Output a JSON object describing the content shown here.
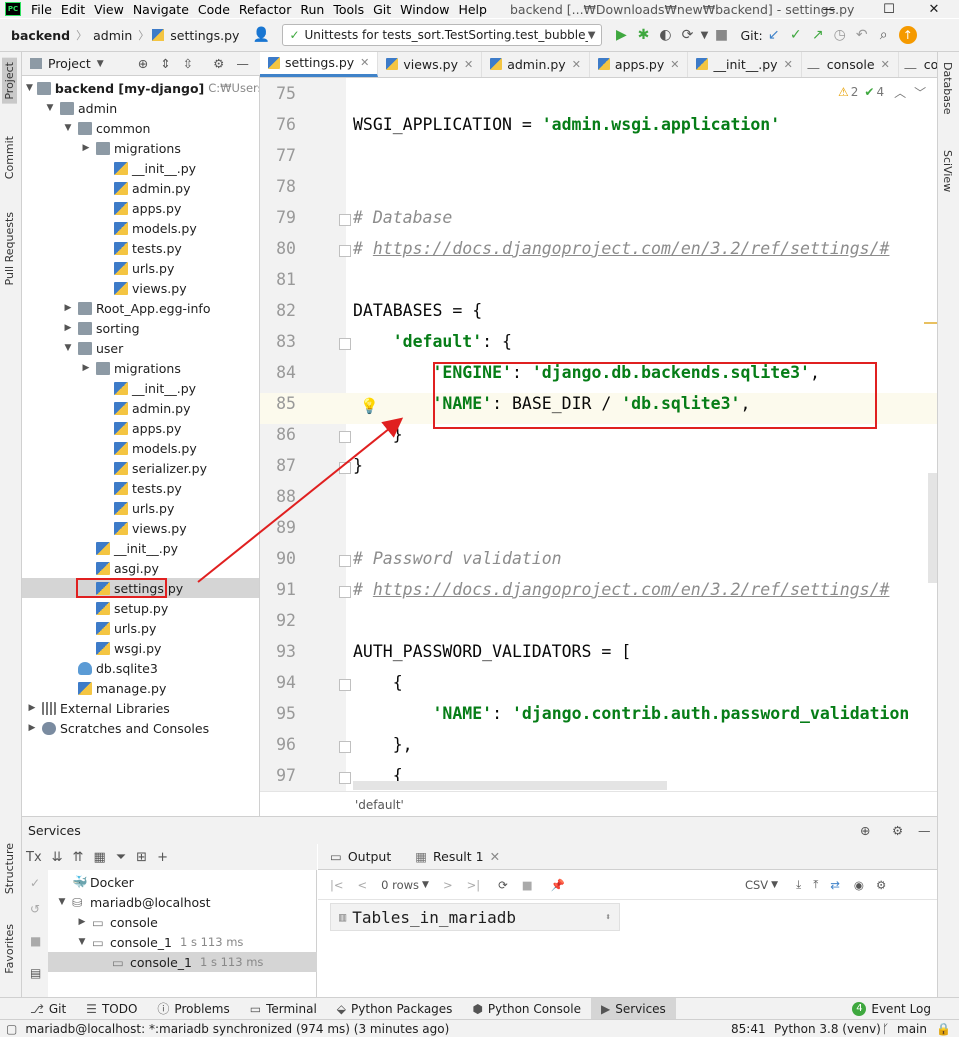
{
  "menubar": {
    "items": [
      "File",
      "Edit",
      "View",
      "Navigate",
      "Code",
      "Refactor",
      "Run",
      "Tools",
      "Git",
      "Window",
      "Help"
    ],
    "window_title": "backend [...₩Downloads₩new₩backend] - settings.py",
    "logo": "PC"
  },
  "toolbar": {
    "crumbs": [
      "backend",
      "admin",
      "settings.py"
    ],
    "run_config": "Unittests for tests_sort.TestSorting.test_bubble_sort",
    "git_label": "Git:"
  },
  "left_strip": {
    "tabs": [
      "Project",
      "Commit",
      "Pull Requests",
      "Structure",
      "Favorites"
    ]
  },
  "right_strip": {
    "tabs": [
      "Database",
      "SciView"
    ]
  },
  "project": {
    "header": "Project",
    "tree": [
      {
        "label": "backend [my-django]",
        "hint": "C:₩Users₩bit",
        "icon": "folder",
        "depth": 0,
        "arrow": "down",
        "bold": true
      },
      {
        "label": "admin",
        "icon": "folder",
        "depth": 1,
        "arrow": "down"
      },
      {
        "label": "common",
        "icon": "folder",
        "depth": 2,
        "arrow": "down"
      },
      {
        "label": "migrations",
        "icon": "folder",
        "depth": 3,
        "arrow": "right"
      },
      {
        "label": "__init__.py",
        "icon": "py",
        "depth": 4
      },
      {
        "label": "admin.py",
        "icon": "py",
        "depth": 4
      },
      {
        "label": "apps.py",
        "icon": "py",
        "depth": 4
      },
      {
        "label": "models.py",
        "icon": "py",
        "depth": 4
      },
      {
        "label": "tests.py",
        "icon": "py",
        "depth": 4
      },
      {
        "label": "urls.py",
        "icon": "py",
        "depth": 4
      },
      {
        "label": "views.py",
        "icon": "py",
        "depth": 4
      },
      {
        "label": "Root_App.egg-info",
        "icon": "folder",
        "depth": 2,
        "arrow": "right"
      },
      {
        "label": "sorting",
        "icon": "folder",
        "depth": 2,
        "arrow": "right"
      },
      {
        "label": "user",
        "icon": "folder",
        "depth": 2,
        "arrow": "down"
      },
      {
        "label": "migrations",
        "icon": "folder",
        "depth": 3,
        "arrow": "right"
      },
      {
        "label": "__init__.py",
        "icon": "py",
        "depth": 4
      },
      {
        "label": "admin.py",
        "icon": "py",
        "depth": 4
      },
      {
        "label": "apps.py",
        "icon": "py",
        "depth": 4
      },
      {
        "label": "models.py",
        "icon": "py",
        "depth": 4
      },
      {
        "label": "serializer.py",
        "icon": "py",
        "depth": 4
      },
      {
        "label": "tests.py",
        "icon": "py",
        "depth": 4
      },
      {
        "label": "urls.py",
        "icon": "py",
        "depth": 4
      },
      {
        "label": "views.py",
        "icon": "py",
        "depth": 4
      },
      {
        "label": "__init__.py",
        "icon": "py",
        "depth": 3
      },
      {
        "label": "asgi.py",
        "icon": "py",
        "depth": 3
      },
      {
        "label": "settings.py",
        "icon": "py",
        "depth": 3,
        "selected": true
      },
      {
        "label": "setup.py",
        "icon": "py",
        "depth": 3
      },
      {
        "label": "urls.py",
        "icon": "py",
        "depth": 3
      },
      {
        "label": "wsgi.py",
        "icon": "py",
        "depth": 3
      },
      {
        "label": "db.sqlite3",
        "icon": "db",
        "depth": 2
      },
      {
        "label": "manage.py",
        "icon": "py",
        "depth": 2
      },
      {
        "label": "External Libraries",
        "icon": "lib",
        "depth": 0,
        "arrow": "right"
      },
      {
        "label": "Scratches and Consoles",
        "icon": "scr",
        "depth": 0,
        "arrow": "right"
      }
    ]
  },
  "editor": {
    "tabs": [
      {
        "label": "settings.py",
        "active": true,
        "kind": "py"
      },
      {
        "label": "views.py",
        "kind": "py"
      },
      {
        "label": "admin.py",
        "kind": "py"
      },
      {
        "label": "apps.py",
        "kind": "py"
      },
      {
        "label": "__init__.py",
        "kind": "py"
      },
      {
        "label": "console",
        "kind": "console"
      },
      {
        "label": "conso",
        "kind": "console"
      }
    ],
    "inspections": {
      "warnings": "2",
      "weak": "4"
    },
    "lines": [
      {
        "n": "75",
        "code": []
      },
      {
        "n": "76",
        "code": [
          [
            "",
            "WSGI_APPLICATION = "
          ],
          [
            "str",
            "'admin.wsgi.application'"
          ]
        ]
      },
      {
        "n": "77",
        "code": []
      },
      {
        "n": "78",
        "code": []
      },
      {
        "n": "79",
        "code": [
          [
            "cm",
            "# Database"
          ]
        ],
        "fold": true
      },
      {
        "n": "80",
        "code": [
          [
            "cm",
            "# "
          ],
          [
            "lnk",
            "https://docs.djangoproject.com/en/3.2/ref/settings/#"
          ]
        ],
        "fold": true
      },
      {
        "n": "81",
        "code": []
      },
      {
        "n": "82",
        "code": [
          [
            "",
            "DATABASES = {"
          ]
        ]
      },
      {
        "n": "83",
        "code": [
          [
            "",
            "    "
          ],
          [
            "str",
            "'default'"
          ],
          [
            "",
            ": {"
          ]
        ],
        "fold": true
      },
      {
        "n": "84",
        "code": [
          [
            "",
            "        "
          ],
          [
            "str",
            "'ENGINE'"
          ],
          [
            "",
            ": "
          ],
          [
            "str",
            "'django.db.backends.sqlite3'"
          ],
          [
            "",
            ","
          ]
        ]
      },
      {
        "n": "85",
        "code": [
          [
            "",
            "        "
          ],
          [
            "str",
            "'NAME'"
          ],
          [
            "",
            ": BASE_DIR / "
          ],
          [
            "str",
            "'db.sqlite3'"
          ],
          [
            "",
            ","
          ]
        ]
      },
      {
        "n": "86",
        "code": [
          [
            "",
            "    }"
          ]
        ],
        "fold": true
      },
      {
        "n": "87",
        "code": [
          [
            "",
            "}"
          ]
        ],
        "fold": true
      },
      {
        "n": "88",
        "code": []
      },
      {
        "n": "89",
        "code": []
      },
      {
        "n": "90",
        "code": [
          [
            "cm",
            "# Password validation"
          ]
        ],
        "fold": true
      },
      {
        "n": "91",
        "code": [
          [
            "cm",
            "# "
          ],
          [
            "lnk",
            "https://docs.djangoproject.com/en/3.2/ref/settings/#"
          ]
        ],
        "fold": true
      },
      {
        "n": "92",
        "code": []
      },
      {
        "n": "93",
        "code": [
          [
            "",
            "AUTH_PASSWORD_VALIDATORS = ["
          ]
        ]
      },
      {
        "n": "94",
        "code": [
          [
            "",
            "    {"
          ]
        ],
        "fold": true
      },
      {
        "n": "95",
        "code": [
          [
            "",
            "        "
          ],
          [
            "str",
            "'NAME'"
          ],
          [
            "",
            ": "
          ],
          [
            "str",
            "'django.contrib.auth.password_validation"
          ]
        ]
      },
      {
        "n": "96",
        "code": [
          [
            "",
            "    },"
          ]
        ],
        "fold": true
      },
      {
        "n": "97",
        "code": [
          [
            "",
            "    {"
          ]
        ],
        "fold": true
      }
    ],
    "breadcrumb_status": "'default'"
  },
  "services": {
    "header": "Services",
    "tree": [
      {
        "label": "Docker",
        "depth": 0,
        "icon": "docker"
      },
      {
        "label": "mariadb@localhost",
        "depth": 0,
        "arrow": "down",
        "icon": "db"
      },
      {
        "label": "console",
        "depth": 1,
        "arrow": "right",
        "icon": "console"
      },
      {
        "label": "console_1",
        "hint": "1 s 113 ms",
        "depth": 1,
        "arrow": "down",
        "icon": "console"
      },
      {
        "label": "console_1",
        "hint": "1 s 113 ms",
        "depth": 2,
        "icon": "console",
        "selected": true
      }
    ],
    "output_tabs": [
      {
        "label": "Output"
      },
      {
        "label": "Result 1",
        "active": true
      }
    ],
    "rows_label": "0 rows",
    "export_label": "CSV",
    "column_header": "Tables_in_mariadb"
  },
  "bottom_tabs": [
    "Git",
    "TODO",
    "Problems",
    "Terminal",
    "Python Packages",
    "Python Console",
    "Services"
  ],
  "event_log": {
    "count": "4",
    "label": "Event Log"
  },
  "statusbar": {
    "message": "mariadb@localhost: *:mariadb synchronized (974 ms) (3 minutes ago)",
    "position": "85:41",
    "interpreter": "Python 3.8 (venv)",
    "branch": "main"
  },
  "colors": {
    "annotation": "#e02020",
    "accent": "#4083c9",
    "string": "#067d17"
  }
}
